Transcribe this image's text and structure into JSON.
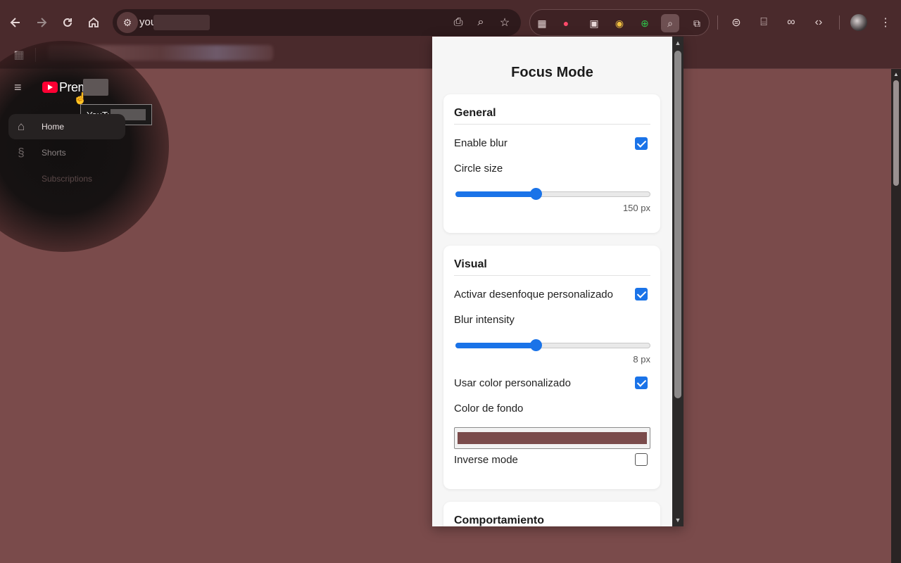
{
  "browser": {
    "url_text": "you",
    "icons": {
      "back": "back-arrow-icon",
      "forward": "forward-arrow-icon",
      "reload": "reload-icon",
      "home": "home-icon"
    }
  },
  "youtube": {
    "brand": "Prem",
    "tooltip": "YouTu",
    "nav": [
      {
        "label": "Home",
        "icon": "home-icon"
      },
      {
        "label": "Shorts",
        "icon": "shorts-icon"
      },
      {
        "label": "Subscriptions",
        "icon": "subscriptions-icon"
      }
    ]
  },
  "popup": {
    "title": "Focus Mode",
    "general": {
      "title": "General",
      "enable_blur_label": "Enable blur",
      "enable_blur_checked": true,
      "circle_size_label": "Circle size",
      "circle_size_value": "150 px",
      "circle_size_fraction": 0.41
    },
    "visual": {
      "title": "Visual",
      "custom_blur_label": "Activar desenfoque personalizado",
      "custom_blur_checked": true,
      "blur_intensity_label": "Blur intensity",
      "blur_intensity_value": "8 px",
      "blur_intensity_fraction": 0.41,
      "custom_color_label": "Usar color personalizado",
      "custom_color_checked": true,
      "bg_color_label": "Color de fondo",
      "bg_color": "#7a4b4b",
      "inverse_label": "Inverse mode",
      "inverse_checked": false
    },
    "behavior": {
      "title": "Comportamiento"
    }
  },
  "colors": {
    "accent": "#1a73e8",
    "page_bg": "#7a4b4b",
    "chrome_bg": "#4a2a2c"
  }
}
